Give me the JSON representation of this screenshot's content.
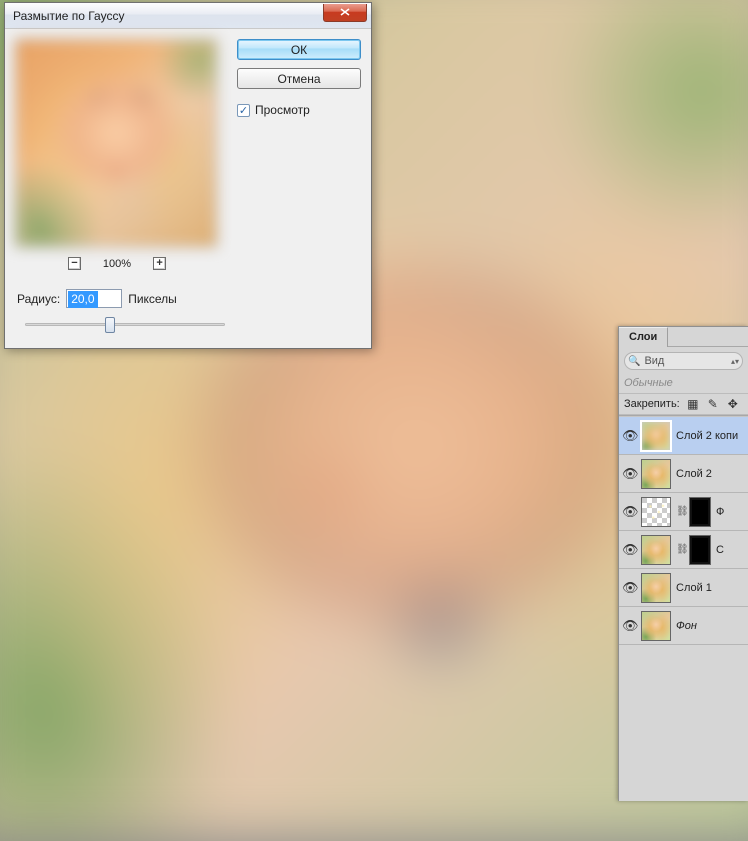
{
  "dialog": {
    "title": "Размытие по Гауссу",
    "ok_label": "ОК",
    "cancel_label": "Отмена",
    "preview_label": "Просмотр",
    "preview_checked": true,
    "zoom_pct": "100%",
    "radius_label": "Радиус:",
    "radius_value": "20,0",
    "radius_unit": "Пикселы"
  },
  "layers_panel": {
    "tab_label": "Слои",
    "search_placeholder": "Вид",
    "blend_mode": "Обычные",
    "lock_label": "Закрепить:",
    "layers": [
      {
        "name": "Слой 2 копи",
        "selected": true,
        "has_mask": false,
        "thumb": "blur",
        "italic": false
      },
      {
        "name": "Слой 2",
        "selected": false,
        "has_mask": false,
        "thumb": "sharp",
        "italic": false
      },
      {
        "name": "Ф",
        "selected": false,
        "has_mask": true,
        "thumb": "checker",
        "italic": false
      },
      {
        "name": "С",
        "selected": false,
        "has_mask": true,
        "thumb": "sharp",
        "italic": false
      },
      {
        "name": "Слой 1",
        "selected": false,
        "has_mask": false,
        "thumb": "sharp",
        "italic": false
      },
      {
        "name": "Фон",
        "selected": false,
        "has_mask": false,
        "thumb": "sharp",
        "italic": true
      }
    ]
  }
}
